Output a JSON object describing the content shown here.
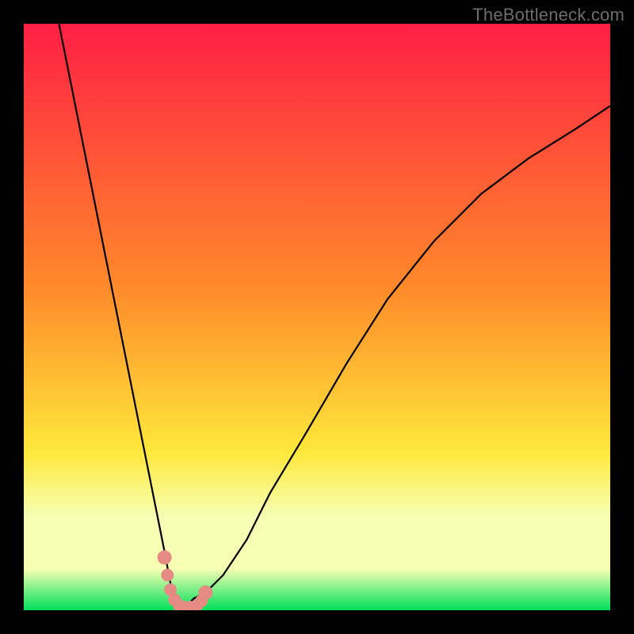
{
  "watermark": "TheBottleneck.com",
  "colors": {
    "bg_black": "#000000",
    "grad_top": "#ff1f44",
    "grad_orange": "#ff8a2a",
    "grad_yellow": "#ffe83a",
    "grad_pale": "#f6ffb3",
    "grad_green": "#00e05a",
    "curve": "#000000",
    "markers": "#e58b84",
    "watermark": "#6d6d6d"
  },
  "chart_data": {
    "type": "line",
    "title": "",
    "xlabel": "",
    "ylabel": "",
    "xlim": [
      0,
      100
    ],
    "ylim": [
      0,
      100
    ],
    "grid": false,
    "series": [
      {
        "name": "bottleneck-curve",
        "x": [
          6,
          8,
          10,
          12,
          14,
          16,
          18,
          20,
          22,
          24,
          25.5,
          27,
          29,
          31,
          34,
          38,
          42,
          48,
          55,
          62,
          70,
          78,
          86,
          94,
          100
        ],
        "values": [
          100,
          90,
          80,
          70,
          60,
          50,
          40,
          30,
          20,
          10,
          2,
          0,
          2,
          3,
          6,
          12,
          20,
          30,
          42,
          53,
          63,
          71,
          77,
          82,
          86
        ]
      }
    ],
    "markers": {
      "name": "highlighted-points",
      "x": [
        24.0,
        24.5,
        25.0,
        25.7,
        26.5,
        27.5,
        28.5,
        29.5,
        30.3,
        31.0
      ],
      "values": [
        9.0,
        6.0,
        3.5,
        1.8,
        0.8,
        0.5,
        0.5,
        0.8,
        1.6,
        3.0
      ]
    },
    "gradient_stops_pct": {
      "top_red": 0,
      "orange": 45,
      "yellow": 73,
      "pale_band_start": 84,
      "pale_band_end": 93,
      "green": 100
    }
  }
}
